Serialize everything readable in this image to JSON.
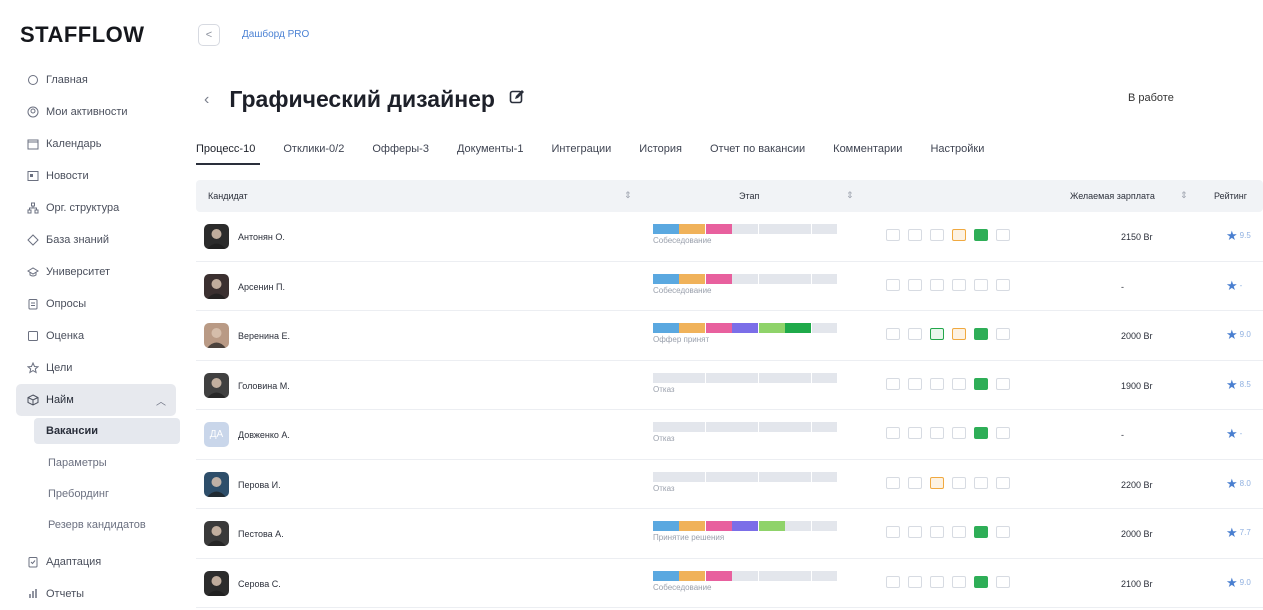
{
  "app": {
    "logo": "STAFFLOW"
  },
  "sidebar": {
    "items": [
      {
        "label": "Главная",
        "icon": "home-icon"
      },
      {
        "label": "Мои активности",
        "icon": "activity-icon"
      },
      {
        "label": "Календарь",
        "icon": "calendar-icon"
      },
      {
        "label": "Новости",
        "icon": "news-icon"
      },
      {
        "label": "Орг. структура",
        "icon": "org-structure-icon"
      },
      {
        "label": "База знаний",
        "icon": "knowledge-base-icon"
      },
      {
        "label": "Университет",
        "icon": "university-icon"
      },
      {
        "label": "Опросы",
        "icon": "survey-icon"
      },
      {
        "label": "Оценка",
        "icon": "evaluation-icon"
      },
      {
        "label": "Цели",
        "icon": "goals-icon"
      },
      {
        "label": "Найм",
        "icon": "hiring-icon"
      }
    ],
    "sub_items": [
      "Вакансии",
      "Параметры",
      "Пребординг",
      "Резерв кандидатов"
    ],
    "bottom_items": [
      {
        "label": "Адаптация",
        "icon": "adaptation-icon"
      },
      {
        "label": "Отчеты",
        "icon": "reports-icon"
      }
    ]
  },
  "header": {
    "breadcrumb": "Дашборд PRO",
    "title": "Графический дизайнер",
    "status": "В работе"
  },
  "tabs": [
    "Процесс-10",
    "Отклики-0/2",
    "Офферы-3",
    "Документы-1",
    "Интеграции",
    "История",
    "Отчет по вакансии",
    "Комментарии",
    "Настройки"
  ],
  "table": {
    "columns": {
      "candidate": "Кандидат",
      "stage": "Этап",
      "salary": "Желаемая зарплата",
      "rating": "Рейтинг"
    },
    "rows": [
      {
        "name": "Антонян О.",
        "stage": "Собеседование",
        "salary": "2150 Br",
        "rating": "9.5",
        "initials": "",
        "segments": [
          "#5aa8e0",
          "#f0b25a",
          "#e8609e",
          "",
          "",
          "",
          ""
        ],
        "icons": [
          "",
          "",
          "",
          "orange",
          "gd",
          ""
        ]
      },
      {
        "name": "Арсенин П.",
        "stage": "Собеседование",
        "salary": "-",
        "rating": "-",
        "initials": "",
        "segments": [
          "#5aa8e0",
          "#f0b25a",
          "#e8609e",
          "",
          "",
          "",
          ""
        ],
        "icons": [
          "",
          "",
          "",
          "",
          "",
          ""
        ]
      },
      {
        "name": "Веренина Е.",
        "stage": "Оффер принят",
        "salary": "2000 Br",
        "rating": "9.0",
        "initials": "",
        "segments": [
          "#5aa8e0",
          "#f0b25a",
          "#e8609e",
          "#7b6ee8",
          "#8fd36a",
          "#1faa4a",
          ""
        ],
        "icons": [
          "",
          "",
          "green",
          "orange",
          "gd",
          ""
        ]
      },
      {
        "name": "Головина М.",
        "stage": "Отказ",
        "salary": "1900 Br",
        "rating": "8.5",
        "initials": "",
        "segments": [
          "",
          "",
          "",
          "",
          "",
          "",
          ""
        ],
        "icons": [
          "",
          "",
          "",
          "",
          "gd",
          ""
        ]
      },
      {
        "name": "Довженко А.",
        "stage": "Отказ",
        "salary": "-",
        "rating": "-",
        "initials": "ДА",
        "segments": [
          "",
          "",
          "",
          "",
          "",
          "",
          ""
        ],
        "icons": [
          "",
          "",
          "",
          "",
          "gd",
          ""
        ]
      },
      {
        "name": "Перова И.",
        "stage": "Отказ",
        "salary": "2200 Br",
        "rating": "8.0",
        "initials": "",
        "segments": [
          "",
          "",
          "",
          "",
          "",
          "",
          ""
        ],
        "icons": [
          "",
          "",
          "orange",
          "",
          "",
          ""
        ]
      },
      {
        "name": "Пестова А.",
        "stage": "Принятие решения",
        "salary": "2000 Br",
        "rating": "7.7",
        "initials": "",
        "segments": [
          "#5aa8e0",
          "#f0b25a",
          "#e8609e",
          "#7b6ee8",
          "#8fd36a",
          "",
          ""
        ],
        "icons": [
          "",
          "",
          "",
          "",
          "gd",
          ""
        ]
      },
      {
        "name": "Серова С.",
        "stage": "Собеседование",
        "salary": "2100 Br",
        "rating": "9.0",
        "initials": "",
        "segments": [
          "#5aa8e0",
          "#f0b25a",
          "#e8609e",
          "",
          "",
          "",
          ""
        ],
        "icons": [
          "",
          "",
          "",
          "",
          "gd",
          ""
        ]
      }
    ]
  }
}
